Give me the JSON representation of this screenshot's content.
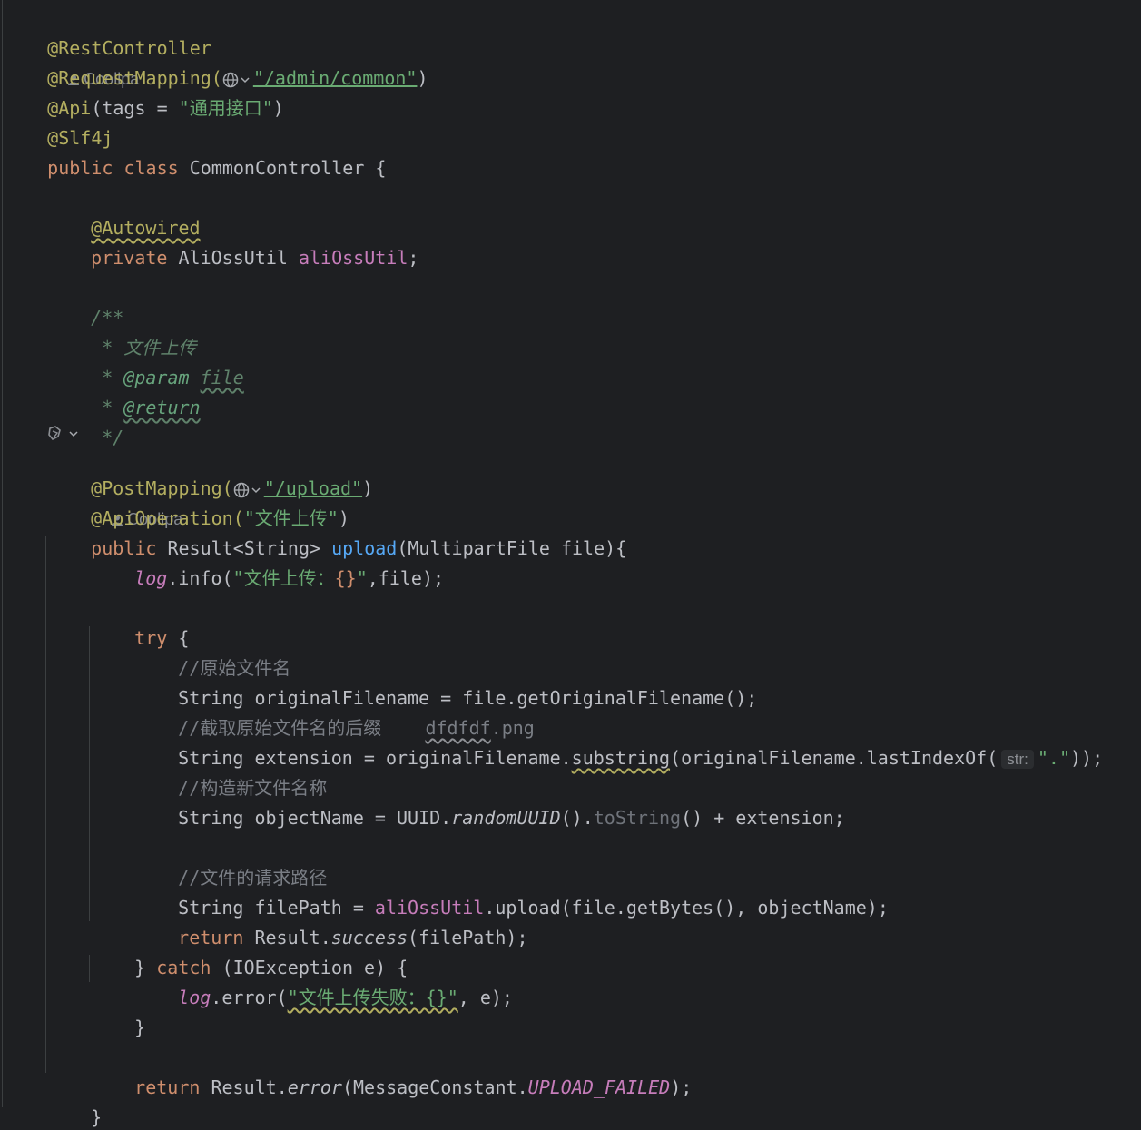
{
  "author": "Coolipa",
  "annotations": {
    "rest_controller": "@RestController",
    "request_mapping": "@RequestMapping(",
    "request_mapping_path": "\"/admin/common\"",
    "api": "@Api",
    "api_args_open": "(tags = ",
    "api_tags": "\"通用接口\"",
    "slf4j": "@Slf4j",
    "autowired": "@Autowired",
    "post_mapping": "@PostMapping(",
    "post_mapping_path": "\"/upload\"",
    "api_operation": "@ApiOperation(",
    "api_operation_value": "\"文件上传\""
  },
  "class_decl": {
    "modifiers": "public class",
    "name": " CommonController {"
  },
  "field": {
    "modifier": "private",
    "type": " AliOssUtil ",
    "name": "aliOssUtil"
  },
  "javadoc": {
    "open": "/**",
    "desc": " * 文件上传",
    "param_prefix": " * ",
    "param_tag": "@param",
    "param_name": "file",
    "return_tag": "@return",
    "close": " */"
  },
  "method": {
    "modifier": "public",
    "return_type": " Result<String> ",
    "name": "upload",
    "params": "(MultipartFile file){"
  },
  "body": {
    "log": "log",
    "info_call": ".info(",
    "info_str_a": "\"文件上传：",
    "info_placeholder": "{}",
    "info_str_b": "\"",
    "info_rest": ",file);",
    "try_kw": "try",
    "try_brace": " {",
    "comment_original": "//原始文件名",
    "line_original": "String originalFilename = file.getOriginalFilename();",
    "comment_suffix": "//截取原始文件名的后缀",
    "comment_suffix_example_a": "dfdfdf",
    "comment_suffix_example_b": ".png",
    "ext_a": "String extension = originalFilename.",
    "ext_substring": "substring",
    "ext_b": "(originalFilename.lastIndexOf(",
    "inlay_hint": "str:",
    "ext_dot": "\".\"",
    "ext_c": "));",
    "comment_new_name": "//构造新文件名称",
    "obj_a": "String objectName = UUID.",
    "obj_random": "randomUUID",
    "obj_b": "().",
    "obj_tostring": "toString",
    "obj_c": "() + extension;",
    "comment_path": "//文件的请求路径",
    "path_a": "String filePath = ",
    "path_b": ".upload(file.getBytes(), objectName);",
    "return_kw": "return",
    "return_a": " Result.",
    "return_success": "success",
    "return_b": "(filePath);",
    "catch_open": "} ",
    "catch_kw": "catch",
    "catch_rest": " (IOException e) {",
    "error_call": ".error(",
    "error_str": "\"文件上传失败：{}\"",
    "error_rest": ", e);",
    "close_brace": "}",
    "final_return_b": " Result.",
    "final_error": "error",
    "final_c": "(MessageConstant.",
    "final_const": "UPLOAD_FAILED",
    "final_d": ");"
  }
}
